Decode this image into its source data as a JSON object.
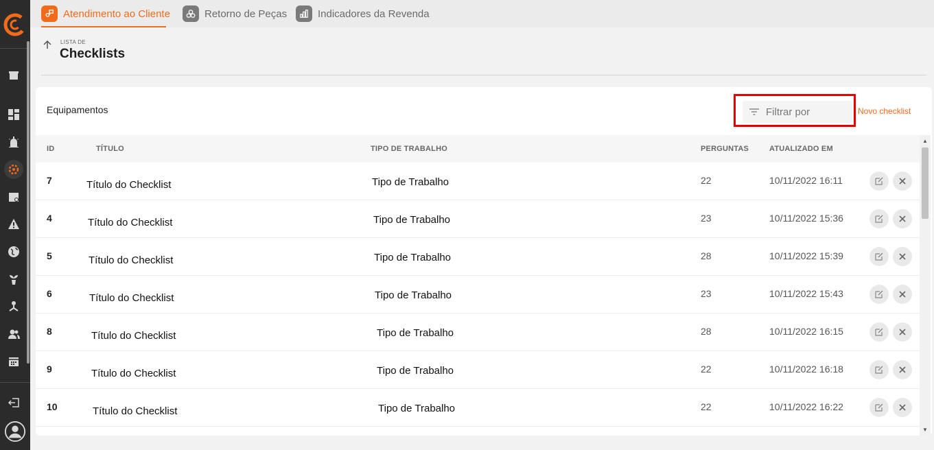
{
  "tabs": [
    {
      "label": "Atendimento ao Cliente",
      "active": true
    },
    {
      "label": "Retorno de Peças",
      "active": false
    },
    {
      "label": "Indicadores da Revenda",
      "active": false
    }
  ],
  "header": {
    "supertitle": "LISTA DE",
    "title": "Checklists"
  },
  "card": {
    "title": "Equipamentos",
    "filter_placeholder": "Filtrar por",
    "new_label": "Novo checklist"
  },
  "table": {
    "columns": [
      "ID",
      "TÍTULO",
      "TIPO DE TRABALHO",
      "PERGUNTAS",
      "ATUALIZADO EM"
    ],
    "rows": [
      {
        "id": "7",
        "title": "Título do Checklist",
        "tipo": "Tipo de Trabalho",
        "perguntas": "22",
        "atualizado": "10/11/2022 16:11"
      },
      {
        "id": "4",
        "title": "Título do Checklist",
        "tipo": "Tipo de Trabalho",
        "perguntas": "23",
        "atualizado": "10/11/2022 15:36"
      },
      {
        "id": "5",
        "title": "Título do Checklist",
        "tipo": "Tipo de Trabalho",
        "perguntas": "28",
        "atualizado": "10/11/2022 15:39"
      },
      {
        "id": "6",
        "title": "Título do Checklist",
        "tipo": "Tipo de Trabalho",
        "perguntas": "23",
        "atualizado": "10/11/2022 15:43"
      },
      {
        "id": "8",
        "title": "Título do Checklist",
        "tipo": "Tipo de Trabalho",
        "perguntas": "28",
        "atualizado": "10/11/2022 16:15"
      },
      {
        "id": "9",
        "title": "Título do Checklist",
        "tipo": "Tipo de Trabalho",
        "perguntas": "22",
        "atualizado": "10/11/2022 16:18"
      },
      {
        "id": "10",
        "title": "Título do Checklist",
        "tipo": "Tipo de Trabalho",
        "perguntas": "22",
        "atualizado": "10/11/2022 16:22"
      }
    ]
  },
  "colors": {
    "accent": "#f26a1b",
    "sidebar": "#2b2b2b",
    "highlight": "#e60000"
  }
}
